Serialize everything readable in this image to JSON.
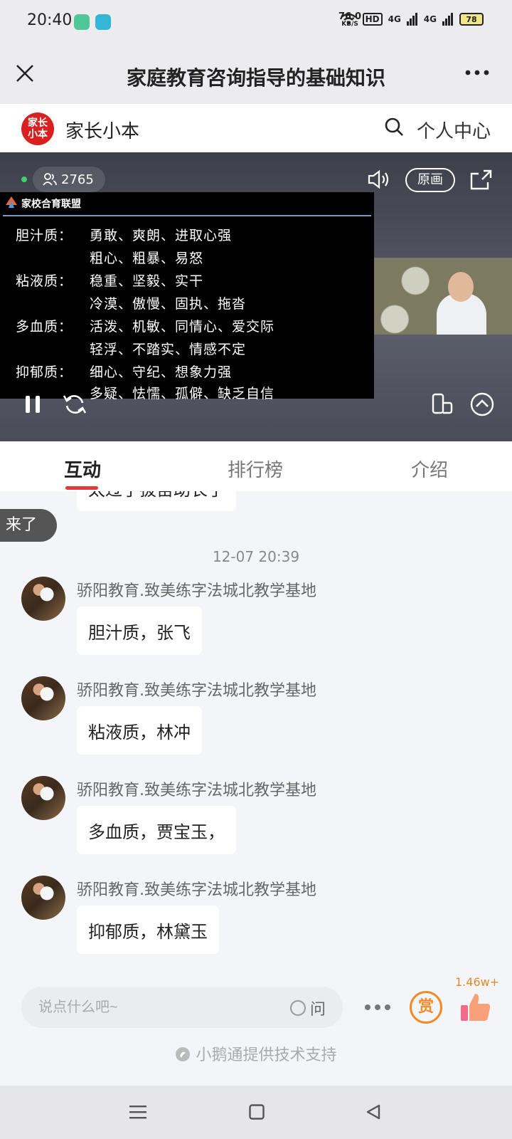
{
  "status_bar": {
    "time": "20:40",
    "net_speed": "76.0",
    "net_unit": "KB/S",
    "hd": "HD",
    "sig1": "4G",
    "sig2": "4G",
    "battery": "78"
  },
  "titlebar": {
    "title": "家庭教育咨询指导的基础知识"
  },
  "brand": {
    "logo_text": "家长小本",
    "name": "家长小本",
    "user_center": "个人中心"
  },
  "video": {
    "viewer_count": "2765",
    "original_label": "原画",
    "slide": {
      "header": "家校合育联盟",
      "rows": [
        {
          "label": "胆汁质：",
          "text": "勇敢、爽朗、进取心强"
        },
        {
          "label": "",
          "text": "粗心、粗暴、易怒"
        },
        {
          "label": "粘液质：",
          "text": "稳重、坚毅、实干"
        },
        {
          "label": "",
          "text": "冷漠、傲慢、固执、拖沓"
        },
        {
          "label": "多血质：",
          "text": "活泼、机敏、同情心、爱交际"
        },
        {
          "label": "",
          "text": "轻浮、不踏实、情感不定"
        },
        {
          "label": "抑郁质：",
          "text": "细心、守纪、想象力强"
        },
        {
          "label": "",
          "text": "多疑、怯懦、孤僻、缺乏自信"
        }
      ]
    }
  },
  "tabs": [
    {
      "label": "互动"
    },
    {
      "label": "排行榜"
    },
    {
      "label": "介绍"
    }
  ],
  "chat": {
    "partial_message": "太过了拔苗助长了",
    "join_toast": "来了",
    "timestamp": "12-07 20:39",
    "messages": [
      {
        "sender": "骄阳教育.致美练字法城北教学基地",
        "text": "胆汁质，张飞"
      },
      {
        "sender": "骄阳教育.致美练字法城北教学基地",
        "text": "粘液质，林冲"
      },
      {
        "sender": "骄阳教育.致美练字法城北教学基地",
        "text": "多血质，贾宝玉，"
      },
      {
        "sender": "骄阳教育.致美练字法城北教学基地",
        "text": "抑郁质，林黛玉"
      }
    ]
  },
  "bottom": {
    "input_placeholder": "说点什么吧~",
    "ask_label": "问",
    "reward_label": "赏",
    "like_count": "1.46w+",
    "powered_by": "小鹅通提供技术支持"
  }
}
